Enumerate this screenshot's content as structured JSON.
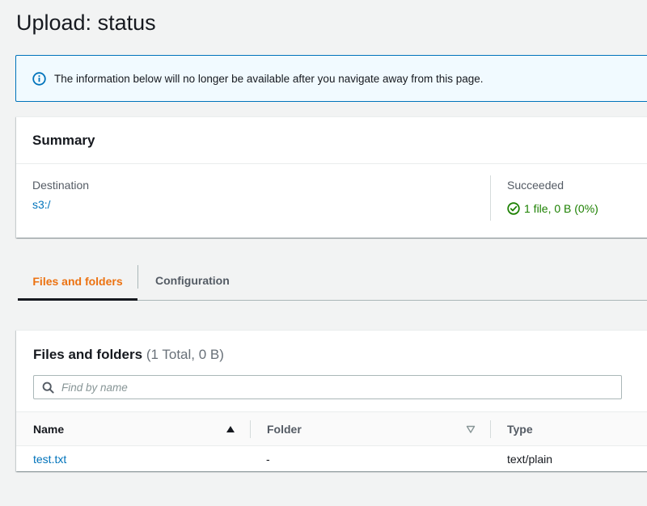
{
  "page": {
    "title": "Upload: status"
  },
  "banner": {
    "icon": "info-icon",
    "text": "The information below will no longer be available after you navigate away from this page."
  },
  "summary": {
    "title": "Summary",
    "destination_label": "Destination",
    "destination_value": "s3:/",
    "succeeded_label": "Succeeded",
    "succeeded_value": "1 file, 0 B (0%)",
    "succeeded_icon": "check-circle-icon"
  },
  "tabs": [
    {
      "label": "Files and folders",
      "active": true
    },
    {
      "label": "Configuration",
      "active": false
    }
  ],
  "files": {
    "title": "Files and folders",
    "count": "(1 Total, 0 B)",
    "search_placeholder": "Find by name",
    "columns": [
      "Name",
      "Folder",
      "Type"
    ],
    "rows": [
      {
        "name": "test.txt",
        "folder": "-",
        "type": "text/plain"
      }
    ]
  },
  "colors": {
    "accent": "#ec7211",
    "link": "#0073bb",
    "success": "#1d8102",
    "banner_border": "#0073bb"
  }
}
